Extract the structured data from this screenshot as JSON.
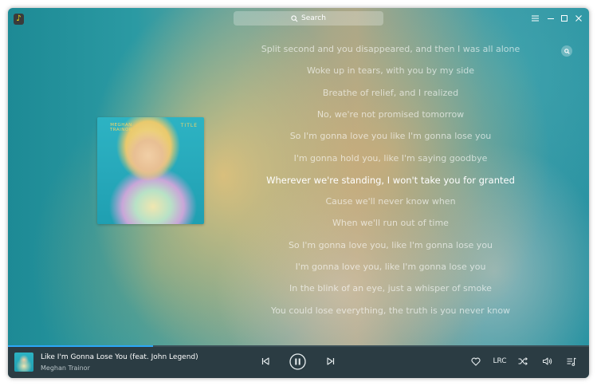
{
  "window": {
    "app_icon_glyph": "♪",
    "search": {
      "label": "Search"
    },
    "controls": [
      "menu-icon",
      "minimize-icon",
      "maximize-icon",
      "close-icon"
    ]
  },
  "album": {
    "artist_text": "MEGHAN TRAINOR",
    "title_text": "TITLE"
  },
  "lyrics": {
    "lines": [
      "Split second and you disappeared, and then I was all alone",
      "Woke up in tears, with you by my side",
      "Breathe of relief, and I realized",
      "No, we're not promised tomorrow",
      "So I'm gonna love you like I'm gonna lose you",
      "I'm gonna hold you, like I'm saying goodbye",
      "Wherever we're standing, I won't take you for granted",
      "Cause we'll never know when",
      "When we'll run out of time",
      "So I'm gonna love you, like I'm gonna lose you",
      "I'm gonna love you, like I'm gonna lose you",
      "In the blink of an eye, just a whisper of smoke",
      "You could lose everything, the truth is you never know"
    ],
    "current_index": 6
  },
  "player": {
    "track_title": "Like I'm Gonna Lose You (feat. John Legend)",
    "track_artist": "Meghan Trainor",
    "progress_fraction": 0.25,
    "lrc_label": "LRC",
    "state": "playing"
  },
  "colors": {
    "accent": "#2ca7f8",
    "player_bar": "#2b3c43"
  }
}
